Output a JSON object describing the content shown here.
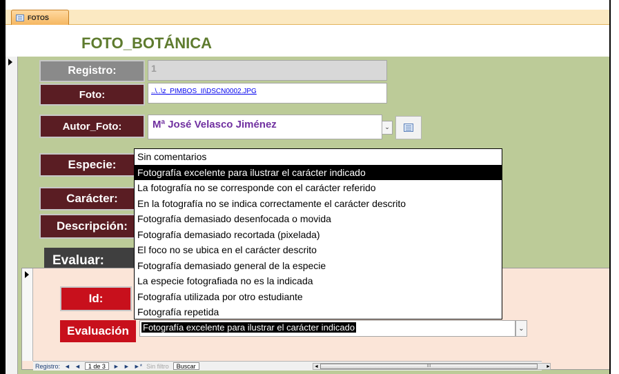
{
  "tab": {
    "label": "FOTOS",
    "icon": "form-icon"
  },
  "form_title": "FOTO_BOTÁNICA",
  "fields": {
    "registro_label": "Registro:",
    "registro_value": "1",
    "foto_label": "Foto:",
    "foto_value": "..\\..\\z_PIMBOS_II\\DSCN0002.JPG",
    "autor_label": "Autor_Foto:",
    "autor_value": "Mª José Velasco Jiménez",
    "especie_label": "Especie:",
    "caracter_label": "Carácter:",
    "descripcion_label": "Descripción:"
  },
  "evaluar": {
    "header": "Evaluar:",
    "id_label": "Id:",
    "evaluacion_label": "Evaluación",
    "evaluacion_value": "Fotografía excelente para ilustrar el carácter indicado"
  },
  "dropdown": {
    "selected_index": 1,
    "options": [
      "Sin comentarios",
      "Fotografía excelente para ilustrar el carácter indicado",
      "La fotografía no se corresponde con el carácter referido",
      "En la fotografía no se indica correctamente el carácter descrito",
      "Fotografía demasiado desenfocada o movida",
      "Fotografía demasiado recortada (pixelada)",
      "El foco no se ubica en el carácter descrito",
      "Fotografía demasiado general de la especie",
      "La especie fotografiada no es la indicada",
      "Fotografía utilizada por otro estudiante",
      "Fotografía repetida"
    ]
  },
  "navbar": {
    "record_label": "Registro:",
    "first": "◄",
    "prev": "◄",
    "position": "1 de 3",
    "next": "►",
    "last": "►",
    "new": "►*",
    "filter": "Sin filtro",
    "search": "Buscar",
    "scroll_mid": "III"
  },
  "colors": {
    "form_bg": "#bccb98",
    "label_dark": "#5a1d23",
    "label_red": "#c8101c",
    "title": "#5e7b2e",
    "autor": "#7030a0"
  }
}
